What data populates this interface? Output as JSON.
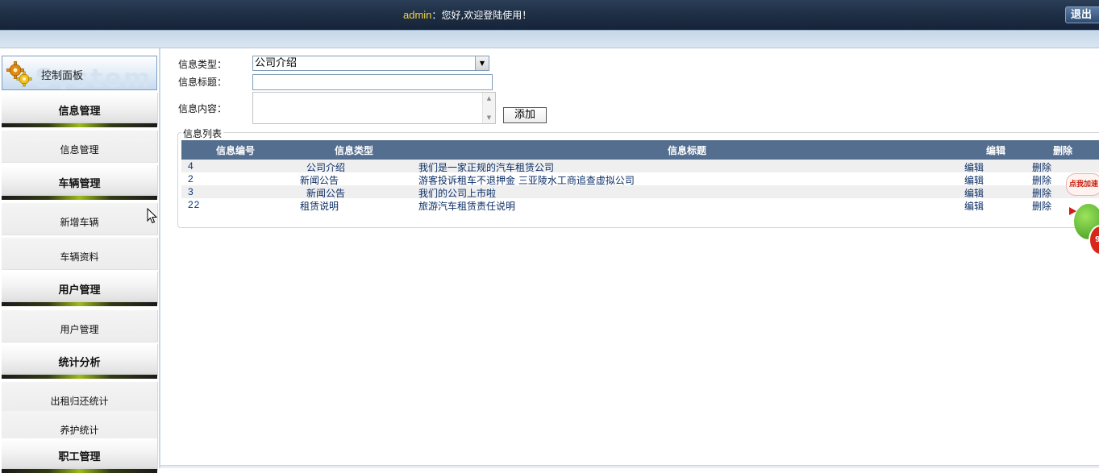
{
  "header": {
    "username": "admin",
    "separator": "：",
    "greeting": "您好,欢迎登陆使用！",
    "logout_label": "退出"
  },
  "sidebar": {
    "panel_title": "控制面板",
    "panel_watermark": "System",
    "groups": [
      {
        "title": "信息管理",
        "items": [
          "信息管理"
        ]
      },
      {
        "title": "车辆管理",
        "items": [
          "新增车辆",
          "车辆资料"
        ]
      },
      {
        "title": "用户管理",
        "items": [
          "用户管理"
        ]
      },
      {
        "title": "统计分析",
        "items": [
          "出租归还统计",
          "养护统计"
        ]
      },
      {
        "title": "职工管理",
        "items": []
      }
    ]
  },
  "form": {
    "type_label": "信息类型：",
    "type_value": "公司介绍",
    "title_label": "信息标题：",
    "title_value": "",
    "content_label": "信息内容：",
    "content_value": "",
    "add_button": "添加"
  },
  "list": {
    "legend": "信息列表",
    "columns": [
      "信息编号",
      "信息类型",
      "信息标题",
      "编辑",
      "删除"
    ],
    "rows": [
      {
        "id": "4",
        "type": "公司介绍",
        "title": "我们是一家正规的汽车租赁公司",
        "edit": "编辑",
        "delete": "删除"
      },
      {
        "id": "2",
        "type": "新闻公告",
        "title": "游客投诉租车不退押金  三亚陵水工商追查虚拟公司",
        "edit": "编辑",
        "delete": "删除"
      },
      {
        "id": "3",
        "type": "新闻公告",
        "title": "我们的公司上市啦",
        "edit": "编辑",
        "delete": "删除"
      },
      {
        "id": "22",
        "type": "租赁说明",
        "title": "旅游汽车租赁责任说明",
        "edit": "编辑",
        "delete": "删除"
      }
    ]
  },
  "float_widget": {
    "bubble_text": "点我加速",
    "badge_text": "97"
  },
  "colors": {
    "topbar": "#1d2d42",
    "username": "#f2d44a",
    "table_header": "#546e8f",
    "accent_bar": "#9dbb1e",
    "link_text": "#0c2f66"
  }
}
